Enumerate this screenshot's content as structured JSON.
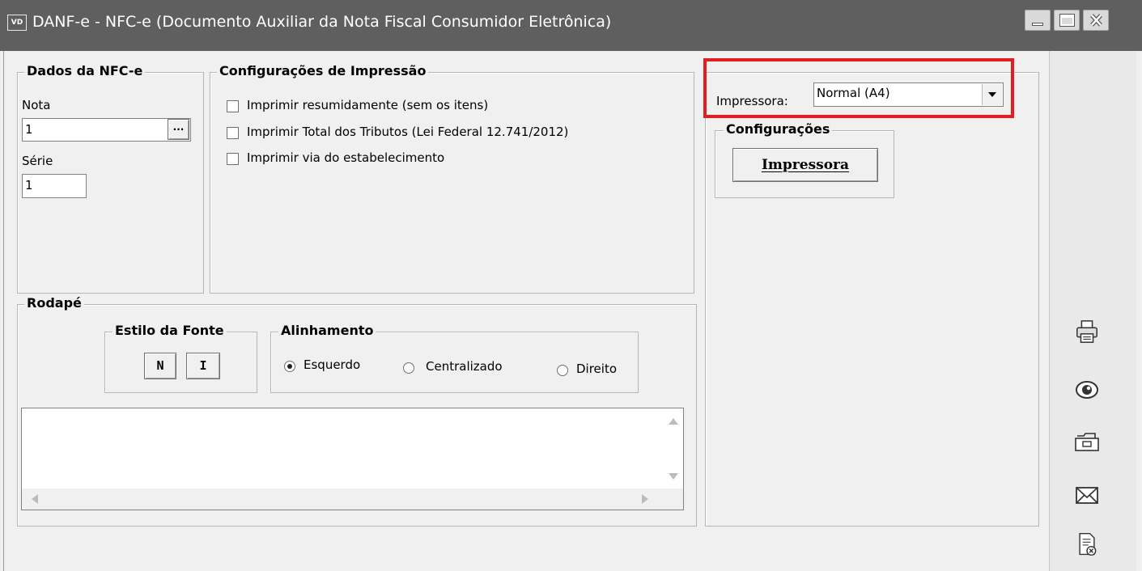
{
  "window": {
    "app_icon": "VD",
    "title": "DANF-e - NFC-e (Documento Auxiliar da Nota Fiscal Consumidor Eletrônica)",
    "controls": [
      "minimize-icon",
      "maximize-icon",
      "close-icon"
    ]
  },
  "dados": {
    "legend": "Dados da NFC-e",
    "nota_label": "Nota",
    "nota_value": "1",
    "lookup_button": "...",
    "serie_label": "Série",
    "serie_value": "1"
  },
  "impressao": {
    "legend": "Configurações de Impressão",
    "options": [
      {
        "label": "Imprimir resumidamente (sem os itens)",
        "checked": false
      },
      {
        "label": "Imprimir Total dos Tributos (Lei Federal 12.741/2012)",
        "checked": false
      },
      {
        "label": "Imprimir via do estabelecimento",
        "checked": false
      }
    ]
  },
  "printer": {
    "label": "Impressora:",
    "selected": "Normal (A4)",
    "config_legend": "Configurações",
    "config_button": "Impressora",
    "highlight_color": "#e41e1e"
  },
  "rodape": {
    "legend": "Rodapé",
    "fonte_legend": "Estilo da Fonte",
    "bold_button": "N",
    "italic_button": "I",
    "alinhamento_legend": "Alinhamento",
    "alignments": [
      {
        "label": "Esquerdo",
        "selected": true
      },
      {
        "label": "Centralizado",
        "selected": false
      },
      {
        "label": "Direito",
        "selected": false
      }
    ],
    "text_value": ""
  },
  "sidebar_icons": [
    "printer-icon",
    "preview-eye-icon",
    "folder-icon",
    "email-icon",
    "cancel-document-icon"
  ]
}
